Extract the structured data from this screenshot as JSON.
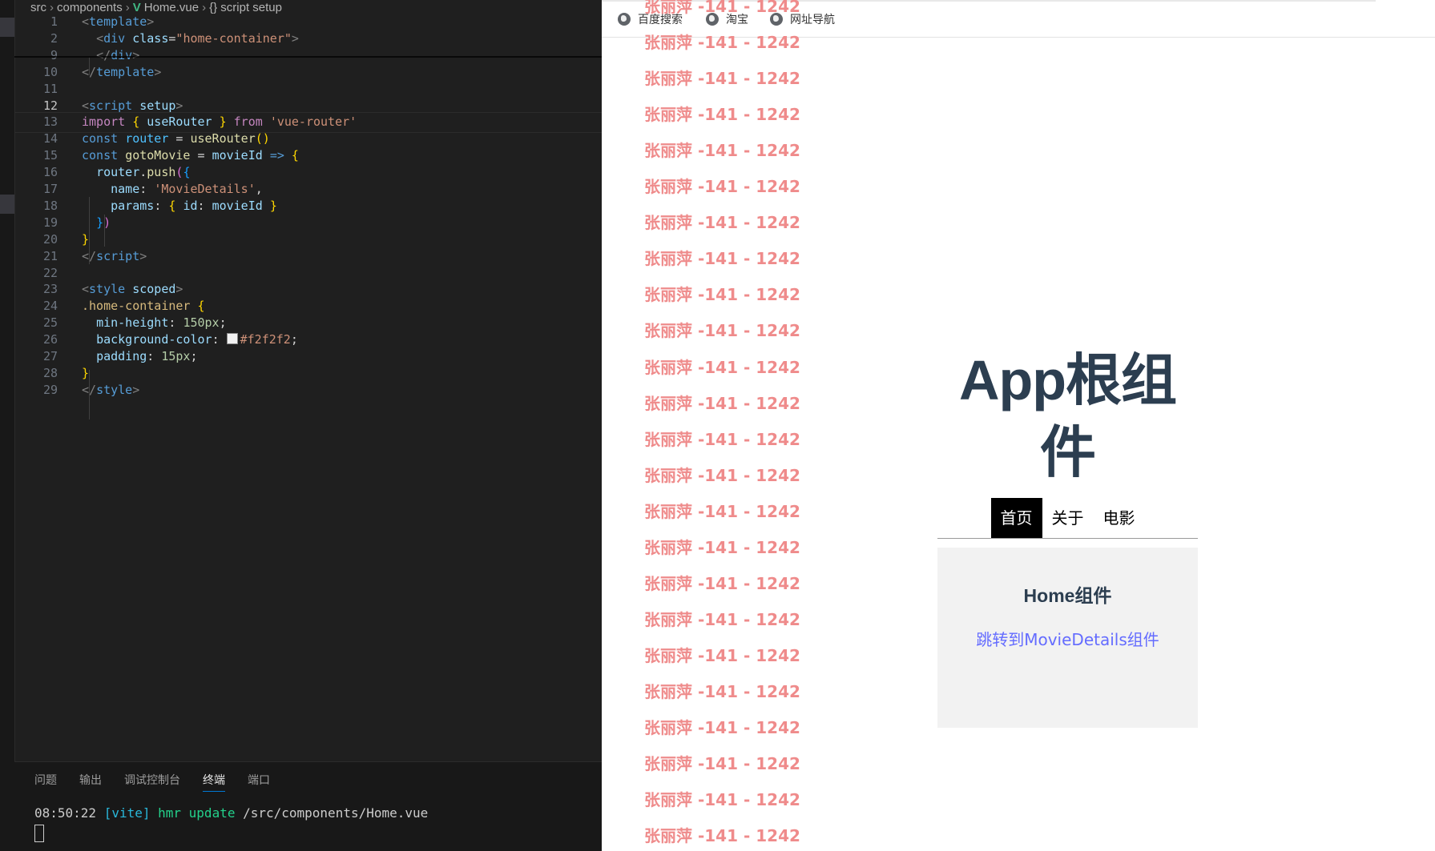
{
  "editor": {
    "breadcrumb": [
      "src",
      "components",
      "Home.vue",
      "{} script setup"
    ],
    "vue_icon": "vue-icon",
    "lines": [
      {
        "n": "1",
        "tokens": [
          [
            "<",
            "#808080"
          ],
          [
            "template",
            "#569cd6"
          ],
          [
            ">",
            "#808080"
          ]
        ]
      },
      {
        "n": "2",
        "tokens": [
          [
            "  ",
            "#d4d4d4"
          ],
          [
            "<",
            "#808080"
          ],
          [
            "div",
            "#569cd6"
          ],
          [
            " ",
            "#d4d4d4"
          ],
          [
            "class",
            "#9cdcfe"
          ],
          [
            "=",
            "#d4d4d4"
          ],
          [
            "\"",
            "#ce9178"
          ],
          [
            "home-container",
            "#ce9178"
          ],
          [
            "\"",
            "#ce9178"
          ],
          [
            ">",
            "#808080"
          ]
        ]
      },
      {
        "n": "9",
        "tokens": [
          [
            "  ",
            "#d4d4d4"
          ],
          [
            "</",
            "#808080"
          ],
          [
            "div",
            "#569cd6"
          ],
          [
            ">",
            "#808080"
          ]
        ]
      },
      {
        "n": "10",
        "tokens": [
          [
            "</",
            "#808080"
          ],
          [
            "template",
            "#569cd6"
          ],
          [
            ">",
            "#808080"
          ]
        ]
      },
      {
        "n": "11",
        "tokens": []
      },
      {
        "n": "12",
        "tokens": [
          [
            "<",
            "#808080"
          ],
          [
            "script",
            "#569cd6"
          ],
          [
            " ",
            "#d4d4d4"
          ],
          [
            "setup",
            "#9cdcfe"
          ],
          [
            ">",
            "#808080"
          ]
        ]
      },
      {
        "n": "13",
        "tokens": [
          [
            "import",
            "#c586c0"
          ],
          [
            " ",
            "#d4d4d4"
          ],
          [
            "{",
            "#ffd700"
          ],
          [
            " ",
            "#d4d4d4"
          ],
          [
            "useRouter",
            "#9cdcfe"
          ],
          [
            " ",
            "#d4d4d4"
          ],
          [
            "}",
            "#ffd700"
          ],
          [
            " ",
            "#d4d4d4"
          ],
          [
            "from",
            "#c586c0"
          ],
          [
            " ",
            "#d4d4d4"
          ],
          [
            "'vue-router'",
            "#ce9178"
          ]
        ]
      },
      {
        "n": "14",
        "tokens": [
          [
            "const",
            "#569cd6"
          ],
          [
            " ",
            "#d4d4d4"
          ],
          [
            "router",
            "#4fc1ff"
          ],
          [
            " = ",
            "#d4d4d4"
          ],
          [
            "useRouter",
            "#dcdcaa"
          ],
          [
            "()",
            "#ffd700"
          ]
        ]
      },
      {
        "n": "15",
        "tokens": [
          [
            "const",
            "#569cd6"
          ],
          [
            " ",
            "#d4d4d4"
          ],
          [
            "gotoMovie",
            "#dcdcaa"
          ],
          [
            " = ",
            "#d4d4d4"
          ],
          [
            "movieId",
            "#9cdcfe"
          ],
          [
            " ",
            "#d4d4d4"
          ],
          [
            "=>",
            "#569cd6"
          ],
          [
            " ",
            "#d4d4d4"
          ],
          [
            "{",
            "#ffd700"
          ]
        ]
      },
      {
        "n": "16",
        "tokens": [
          [
            "  ",
            "#d4d4d4"
          ],
          [
            "router",
            "#9cdcfe"
          ],
          [
            ".",
            "#d4d4d4"
          ],
          [
            "push",
            "#dcdcaa"
          ],
          [
            "(",
            "#da70d6"
          ],
          [
            "{",
            "#179fff"
          ]
        ]
      },
      {
        "n": "17",
        "tokens": [
          [
            "    ",
            "#d4d4d4"
          ],
          [
            "name",
            "#9cdcfe"
          ],
          [
            ": ",
            "#d4d4d4"
          ],
          [
            "'MovieDetails'",
            "#ce9178"
          ],
          [
            ",",
            "#d4d4d4"
          ]
        ]
      },
      {
        "n": "18",
        "tokens": [
          [
            "    ",
            "#d4d4d4"
          ],
          [
            "params",
            "#9cdcfe"
          ],
          [
            ": ",
            "#d4d4d4"
          ],
          [
            "{",
            "#ffd700"
          ],
          [
            " ",
            "#d4d4d4"
          ],
          [
            "id",
            "#9cdcfe"
          ],
          [
            ": ",
            "#d4d4d4"
          ],
          [
            "movieId",
            "#9cdcfe"
          ],
          [
            " ",
            "#d4d4d4"
          ],
          [
            "}",
            "#ffd700"
          ]
        ]
      },
      {
        "n": "19",
        "tokens": [
          [
            "  ",
            "#d4d4d4"
          ],
          [
            "}",
            "#179fff"
          ],
          [
            ")",
            "#da70d6"
          ]
        ]
      },
      {
        "n": "20",
        "tokens": [
          [
            "}",
            "#ffd700"
          ]
        ]
      },
      {
        "n": "21",
        "tokens": [
          [
            "</",
            "#808080"
          ],
          [
            "script",
            "#569cd6"
          ],
          [
            ">",
            "#808080"
          ]
        ]
      },
      {
        "n": "22",
        "tokens": []
      },
      {
        "n": "23",
        "tokens": [
          [
            "<",
            "#808080"
          ],
          [
            "style",
            "#569cd6"
          ],
          [
            " ",
            "#d4d4d4"
          ],
          [
            "scoped",
            "#9cdcfe"
          ],
          [
            ">",
            "#808080"
          ]
        ]
      },
      {
        "n": "24",
        "tokens": [
          [
            ".home-container",
            "#d7ba7d"
          ],
          [
            " ",
            "#d4d4d4"
          ],
          [
            "{",
            "#ffd700"
          ]
        ]
      },
      {
        "n": "25",
        "tokens": [
          [
            "  ",
            "#d4d4d4"
          ],
          [
            "min-height",
            "#9cdcfe"
          ],
          [
            ": ",
            "#d4d4d4"
          ],
          [
            "150px",
            "#b5cea8"
          ],
          [
            ";",
            "#d4d4d4"
          ]
        ]
      },
      {
        "n": "26",
        "tokens": [
          [
            "  ",
            "#d4d4d4"
          ],
          [
            "background-color",
            "#9cdcfe"
          ],
          [
            ": ",
            "#d4d4d4"
          ],
          [
            "#f2f2f2",
            "#ce9178",
            "swatch"
          ],
          [
            ";",
            "#d4d4d4"
          ]
        ]
      },
      {
        "n": "27",
        "tokens": [
          [
            "  ",
            "#d4d4d4"
          ],
          [
            "padding",
            "#9cdcfe"
          ],
          [
            ": ",
            "#d4d4d4"
          ],
          [
            "15px",
            "#b5cea8"
          ],
          [
            ";",
            "#d4d4d4"
          ]
        ]
      },
      {
        "n": "28",
        "tokens": [
          [
            "}",
            "#ffd700"
          ]
        ]
      },
      {
        "n": "29",
        "tokens": [
          [
            "</",
            "#808080"
          ],
          [
            "style",
            "#569cd6"
          ],
          [
            ">",
            "#808080"
          ]
        ]
      }
    ],
    "active_line": "12",
    "panel": {
      "tabs": [
        "问题",
        "输出",
        "调试控制台",
        "终端",
        "端口"
      ],
      "active_tab": "终端",
      "terminal": [
        [
          "08:50:22 ",
          "#cccccc"
        ],
        [
          "[vite]",
          "#29b8db"
        ],
        [
          " hmr update ",
          "#23d18b"
        ],
        [
          "/src/components/Home.vue",
          "#cccccc"
        ]
      ]
    }
  },
  "browser": {
    "bookmarks": [
      {
        "label": "百度搜索",
        "icon": "globe-icon"
      },
      {
        "label": "淘宝",
        "icon": "globe-icon"
      },
      {
        "label": "网址导航",
        "icon": "globe-icon"
      }
    ],
    "watermark_text": "张丽萍 -141 - 1242",
    "watermark_count": 24,
    "app": {
      "title": "App根组件",
      "nav": [
        "首页",
        "关于",
        "电影"
      ],
      "active_nav": "首页",
      "home_title": "Home组件",
      "home_link": "跳转到MovieDetails组件"
    }
  },
  "colors": {
    "editor_bg": "#1f1f1f",
    "watermark": "#ef8b8b",
    "title": "#2c3e50",
    "link": "#646cff",
    "home_bg": "#f2f2f2"
  }
}
